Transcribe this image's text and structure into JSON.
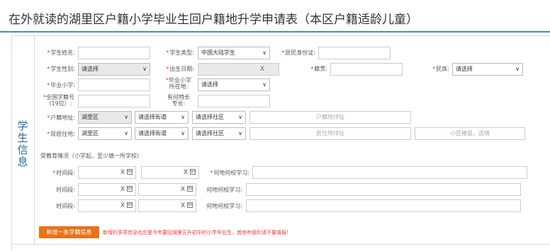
{
  "page": {
    "title": "在外就读的湖里区户籍小学毕业生回户籍地升学申请表（本区户籍适龄儿童）"
  },
  "section": {
    "label": "学生信息"
  },
  "fields": {
    "name": {
      "label": "学生姓名:",
      "value": ""
    },
    "type": {
      "label": "学生类型:",
      "value": "中国大陆学生"
    },
    "id": {
      "label": "居民身份证:",
      "value": ""
    },
    "gender": {
      "label": "学生性别:",
      "value": "请选择"
    },
    "birth": {
      "label": "出生日期:",
      "clear": "X"
    },
    "origin": {
      "label": "籍贯:",
      "value": ""
    },
    "ethnic": {
      "label": "民族:",
      "value": "请选择"
    },
    "school": {
      "label": "毕业小学:",
      "value": ""
    },
    "school_loc": {
      "label_line1": "毕业小学",
      "label_line2": "所在地:",
      "value": "请选择"
    },
    "national_no": {
      "label_line1": "全国学籍号",
      "label_line2": "（19位）:",
      "value": ""
    },
    "talent": {
      "label_line1": "有何特长",
      "label_line2": "专长:",
      "value": ""
    },
    "hukou": {
      "label": "户籍地址:",
      "district": "湖里区",
      "street": "请选择街道",
      "community": "请选择社区",
      "detail_placeholder": "户籍地详址"
    },
    "residence": {
      "label": "现居住地:",
      "district": "湖里区",
      "street": "请选择街道",
      "community": "请选择社区",
      "detail_placeholder": "居住地详址",
      "estate_placeholder": "小区楼盘，选填"
    }
  },
  "education": {
    "heading": "受教育情况（小学起，至少填一所学校）",
    "rows": [
      {
        "time_label": "时间段:",
        "school_label": "何地何校学习:",
        "required": true
      },
      {
        "time_label": "时间段:",
        "school_label": "何地何校学习:",
        "required": false
      },
      {
        "time_label": "时间段:",
        "school_label": "何地何校学习:",
        "required": false
      }
    ],
    "clear": "X"
  },
  "actions": {
    "add_label": "新增一条学籍信息",
    "note": "新增的多项信息也应是今年要回湖里区升初中的小学毕业生，其他年级的请不要填报！"
  },
  "colors": {
    "accent": "#3b8fd0",
    "button": "#e8731a",
    "required": "#ee3333"
  }
}
